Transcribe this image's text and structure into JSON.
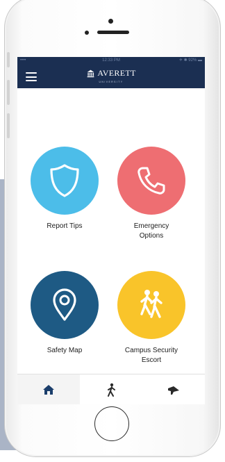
{
  "status_bar": {
    "left": "•••• ",
    "time": "12:33 PM",
    "right": "✈ ✱ 92% ▬"
  },
  "header": {
    "brand_name": "AVERETT",
    "brand_sub": "UNIVERSITY",
    "menu_icon": "hamburger-icon",
    "color": "#1b2f52"
  },
  "tiles": [
    {
      "label": "Report Tips",
      "icon": "shield-icon",
      "color": "#4cbde9"
    },
    {
      "label": "Emergency\nOptions",
      "icon": "phone-icon",
      "color": "#ee6e72"
    },
    {
      "label": "Safety Map",
      "icon": "map-pin-icon",
      "color": "#1e5a84"
    },
    {
      "label": "Campus Security\nEscort",
      "icon": "walking-people-icon",
      "color": "#f9c42a"
    }
  ],
  "tabbar": {
    "items": [
      {
        "icon": "home-icon",
        "active": true
      },
      {
        "icon": "walking-icon",
        "active": false
      },
      {
        "icon": "bullhorn-icon",
        "active": false
      }
    ]
  }
}
